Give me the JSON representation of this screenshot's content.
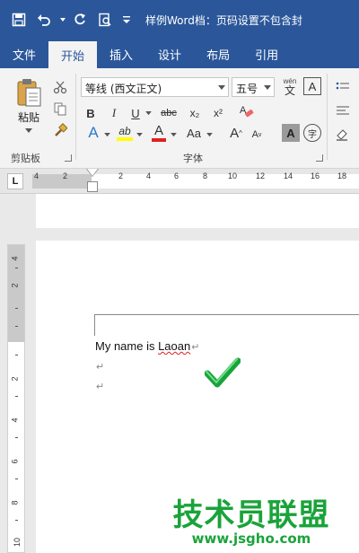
{
  "titlebar": {
    "title": "样例Word档：页码设置不包含封",
    "icons": [
      "save-icon",
      "undo-icon",
      "redo-icon",
      "print-preview-icon",
      "customize-icon"
    ]
  },
  "tabs": [
    {
      "label": "文件"
    },
    {
      "label": "开始"
    },
    {
      "label": "插入"
    },
    {
      "label": "设计"
    },
    {
      "label": "布局"
    },
    {
      "label": "引用"
    }
  ],
  "ribbon": {
    "clipboard": {
      "paste_label": "粘贴",
      "group_label": "剪贴板"
    },
    "font": {
      "font_name": "等线 (西文正文)",
      "font_size": "五号",
      "group_label": "字体",
      "phonetic": "wén",
      "phonetic_char": "文",
      "border_char": "A",
      "bold": "B",
      "italic": "I",
      "underline": "U",
      "strikethrough": "abc",
      "subscript": "x₂",
      "superscript": "x²",
      "text_effects": "A",
      "highlight": "ab",
      "font_color": "A",
      "change_case": "Aa",
      "grow": "A",
      "shrink": "A",
      "shade": "A",
      "enclose": "字"
    }
  },
  "ruler": {
    "tab_selector": "L",
    "numbers": [
      "4",
      "2",
      "2",
      "4",
      "6",
      "8",
      "10",
      "12",
      "14",
      "16",
      "18"
    ],
    "vertical_numbers": [
      "4",
      "2",
      "2",
      "4",
      "6",
      "8",
      "10"
    ]
  },
  "document": {
    "line1": "My name is ",
    "line1_word": "Laoan",
    "para_mark": "↵"
  },
  "watermark": {
    "title": "技术员联盟",
    "url": "www.jsgho.com"
  },
  "colors": {
    "titlebar": "#2b579a",
    "check": "#1aa33a",
    "highlight": "#ffff00",
    "font_color": "#e02020"
  }
}
